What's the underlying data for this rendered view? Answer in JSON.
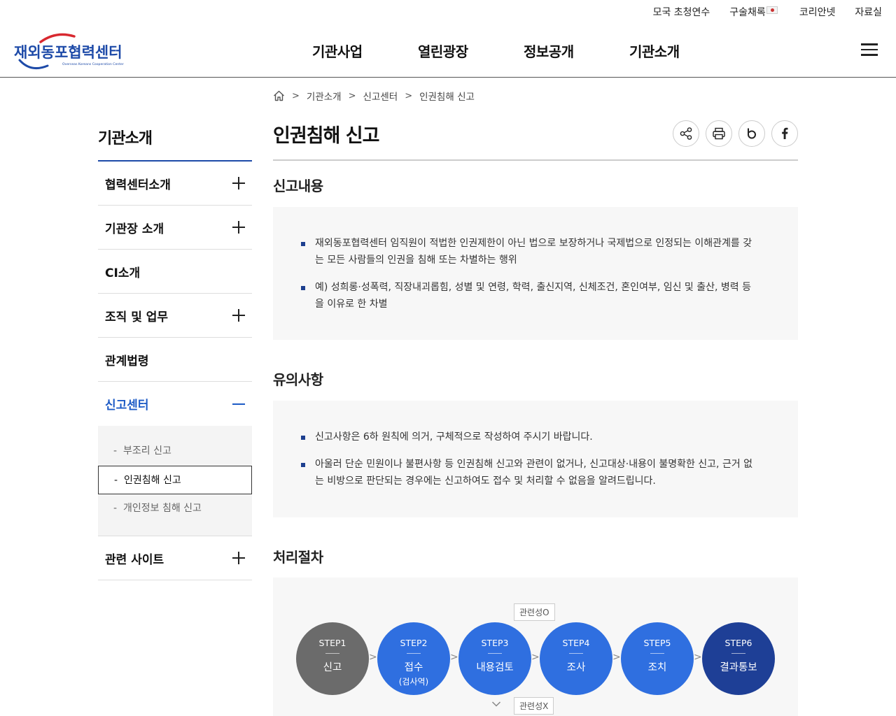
{
  "utility": {
    "items": [
      "모국 초청연수",
      "구술채록",
      "코리안넷",
      "자료실"
    ]
  },
  "logo": {
    "main": "재외동포협력센터",
    "sub": "Overseas Koreans Cooperation Center"
  },
  "gnb": [
    "기관사업",
    "열린광장",
    "정보공개",
    "기관소개"
  ],
  "sidebar": {
    "title": "기관소개",
    "items": [
      {
        "label": "협력센터소개",
        "toggle": "plus"
      },
      {
        "label": "기관장 소개",
        "toggle": "plus"
      },
      {
        "label": "CI소개",
        "toggle": "none"
      },
      {
        "label": "조직 및 업무",
        "toggle": "plus"
      },
      {
        "label": "관계법령",
        "toggle": "none"
      },
      {
        "label": "신고센터",
        "toggle": "minus"
      },
      {
        "label": "관련 사이트",
        "toggle": "plus"
      }
    ],
    "sub": [
      "부조리 신고",
      "인권침해 신고",
      "개인정보 침해 신고"
    ]
  },
  "breadcrumb": [
    "기관소개",
    "신고센터",
    "인권침해 신고"
  ],
  "page_title": "인권침해 신고",
  "sections": {
    "content_title": "신고내용",
    "content": [
      "재외동포협력센터 임직원이 적법한 인권제한이 아닌 법으로 보장하거나 국제법으로 인정되는 이해관계를 갖는 모든 사람들의 인권을 침해 또는 차별하는 행위",
      "예) 성희롱·성폭력, 직장내괴롭힘, 성별 및 연령, 학력, 출신지역, 신체조건, 혼인여부, 임신 및 출산, 병력 등을 이유로 한 차별"
    ],
    "notice_title": "유의사항",
    "notice": [
      "신고사항은 6하 원칙에 의거, 구체적으로 작성하여 주시기 바랍니다.",
      "아울러 단순 민원이나 불편사항 등 인권침해 신고와 관련이 없거나, 신고대상·내용이 불명확한 신고, 근거 없는 비방으로 판단되는 경우에는 신고하여도 접수 및 처리할 수 없음을 알려드립니다."
    ],
    "process_title": "처리절차"
  },
  "process": {
    "tag_yes": "관련성O",
    "tag_no": "관련성X",
    "steps": [
      {
        "step": "STEP1",
        "label": "신고",
        "extra": "",
        "color": "#6b6b6b"
      },
      {
        "step": "STEP2",
        "label": "접수",
        "extra": "(검사역)",
        "color": "#2f6fe0"
      },
      {
        "step": "STEP3",
        "label": "내용검토",
        "extra": "",
        "color": "#2f6fe0"
      },
      {
        "step": "STEP4",
        "label": "조사",
        "extra": "",
        "color": "#2f6fe0"
      },
      {
        "step": "STEP5",
        "label": "조치",
        "extra": "",
        "color": "#2f6fe0"
      },
      {
        "step": "STEP6",
        "label": "결과통보",
        "extra": "",
        "color": "#1e3f96"
      }
    ]
  }
}
